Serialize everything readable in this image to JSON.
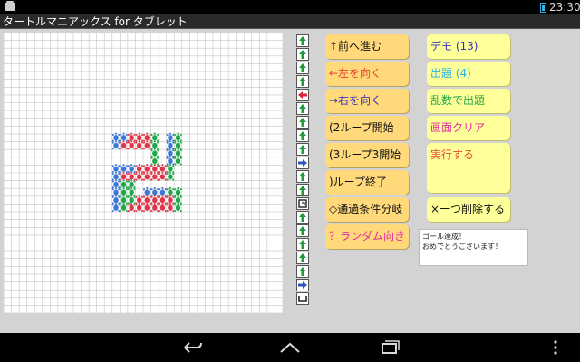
{
  "status_bar": {
    "time": "23:30",
    "app_icon": "game-controller-icon",
    "battery_icon": "battery-icon"
  },
  "title_bar": {
    "title": "タートルマニアックス for タブレット"
  },
  "turtle_canvas": {
    "grid_size": 36,
    "colors": {
      "blue": "#3b78d9",
      "red": "#e0364a",
      "green": "#22a84a",
      "grid": "#c4c4c4"
    },
    "turtles": [
      {
        "col": 14,
        "row": 13,
        "color": "blue"
      },
      {
        "col": 15,
        "row": 13,
        "color": "blue"
      },
      {
        "col": 16,
        "row": 13,
        "color": "red"
      },
      {
        "col": 17,
        "row": 13,
        "color": "red"
      },
      {
        "col": 18,
        "row": 13,
        "color": "red"
      },
      {
        "col": 19,
        "row": 13,
        "color": "green"
      },
      {
        "col": 21,
        "row": 13,
        "color": "blue"
      },
      {
        "col": 22,
        "row": 13,
        "color": "green"
      },
      {
        "col": 14,
        "row": 14,
        "color": "blue"
      },
      {
        "col": 15,
        "row": 14,
        "color": "red"
      },
      {
        "col": 16,
        "row": 14,
        "color": "red"
      },
      {
        "col": 17,
        "row": 14,
        "color": "red"
      },
      {
        "col": 18,
        "row": 14,
        "color": "red"
      },
      {
        "col": 19,
        "row": 14,
        "color": "green"
      },
      {
        "col": 21,
        "row": 14,
        "color": "blue"
      },
      {
        "col": 22,
        "row": 14,
        "color": "green"
      },
      {
        "col": 19,
        "row": 15,
        "color": "green"
      },
      {
        "col": 21,
        "row": 15,
        "color": "blue"
      },
      {
        "col": 22,
        "row": 15,
        "color": "green"
      },
      {
        "col": 19,
        "row": 16,
        "color": "green"
      },
      {
        "col": 21,
        "row": 16,
        "color": "blue"
      },
      {
        "col": 22,
        "row": 16,
        "color": "green"
      },
      {
        "col": 14,
        "row": 17,
        "color": "blue"
      },
      {
        "col": 15,
        "row": 17,
        "color": "blue"
      },
      {
        "col": 16,
        "row": 17,
        "color": "blue"
      },
      {
        "col": 17,
        "row": 17,
        "color": "red"
      },
      {
        "col": 18,
        "row": 17,
        "color": "red"
      },
      {
        "col": 19,
        "row": 17,
        "color": "red"
      },
      {
        "col": 20,
        "row": 17,
        "color": "red"
      },
      {
        "col": 21,
        "row": 17,
        "color": "green"
      },
      {
        "col": 14,
        "row": 18,
        "color": "blue"
      },
      {
        "col": 15,
        "row": 18,
        "color": "red"
      },
      {
        "col": 16,
        "row": 18,
        "color": "red"
      },
      {
        "col": 17,
        "row": 18,
        "color": "red"
      },
      {
        "col": 18,
        "row": 18,
        "color": "red"
      },
      {
        "col": 19,
        "row": 18,
        "color": "red"
      },
      {
        "col": 20,
        "row": 18,
        "color": "red"
      },
      {
        "col": 21,
        "row": 18,
        "color": "green"
      },
      {
        "col": 14,
        "row": 19,
        "color": "blue"
      },
      {
        "col": 15,
        "row": 19,
        "color": "green"
      },
      {
        "col": 16,
        "row": 19,
        "color": "green"
      },
      {
        "col": 14,
        "row": 20,
        "color": "blue"
      },
      {
        "col": 15,
        "row": 20,
        "color": "green"
      },
      {
        "col": 16,
        "row": 20,
        "color": "green"
      },
      {
        "col": 18,
        "row": 20,
        "color": "blue"
      },
      {
        "col": 19,
        "row": 20,
        "color": "blue"
      },
      {
        "col": 20,
        "row": 20,
        "color": "blue"
      },
      {
        "col": 21,
        "row": 20,
        "color": "green"
      },
      {
        "col": 22,
        "row": 20,
        "color": "green"
      },
      {
        "col": 14,
        "row": 21,
        "color": "blue"
      },
      {
        "col": 15,
        "row": 21,
        "color": "green"
      },
      {
        "col": 16,
        "row": 21,
        "color": "green"
      },
      {
        "col": 17,
        "row": 21,
        "color": "red"
      },
      {
        "col": 18,
        "row": 21,
        "color": "red"
      },
      {
        "col": 19,
        "row": 21,
        "color": "red"
      },
      {
        "col": 20,
        "row": 21,
        "color": "red"
      },
      {
        "col": 21,
        "row": 21,
        "color": "red"
      },
      {
        "col": 22,
        "row": 21,
        "color": "green"
      },
      {
        "col": 14,
        "row": 22,
        "color": "blue"
      },
      {
        "col": 15,
        "row": 22,
        "color": "green"
      },
      {
        "col": 16,
        "row": 22,
        "color": "red"
      },
      {
        "col": 17,
        "row": 22,
        "color": "red"
      },
      {
        "col": 18,
        "row": 22,
        "color": "red"
      },
      {
        "col": 19,
        "row": 22,
        "color": "red"
      },
      {
        "col": 20,
        "row": 22,
        "color": "red"
      },
      {
        "col": 21,
        "row": 22,
        "color": "red"
      },
      {
        "col": 22,
        "row": 22,
        "color": "green"
      }
    ]
  },
  "command_list": [
    {
      "icon": "up-arrow-icon",
      "color": "#1f9a3a"
    },
    {
      "icon": "up-arrow-icon",
      "color": "#1f9a3a"
    },
    {
      "icon": "up-arrow-icon",
      "color": "#1f9a3a"
    },
    {
      "icon": "up-arrow-icon",
      "color": "#1f9a3a"
    },
    {
      "icon": "left-arrow-icon",
      "color": "#d8243a"
    },
    {
      "icon": "up-arrow-icon",
      "color": "#1f9a3a"
    },
    {
      "icon": "up-arrow-icon",
      "color": "#1f9a3a"
    },
    {
      "icon": "up-arrow-icon",
      "color": "#1f9a3a"
    },
    {
      "icon": "up-arrow-icon",
      "color": "#1f9a3a"
    },
    {
      "icon": "right-arrow-icon",
      "color": "#2d55c8"
    },
    {
      "icon": "up-arrow-icon",
      "color": "#1f9a3a"
    },
    {
      "icon": "up-arrow-icon",
      "color": "#1f9a3a"
    },
    {
      "icon": "loop-icon",
      "color": "#222222"
    },
    {
      "icon": "up-arrow-icon",
      "color": "#1f9a3a"
    },
    {
      "icon": "up-arrow-icon",
      "color": "#1f9a3a"
    },
    {
      "icon": "up-arrow-icon",
      "color": "#1f9a3a"
    },
    {
      "icon": "up-arrow-icon",
      "color": "#1f9a3a"
    },
    {
      "icon": "up-arrow-icon",
      "color": "#1f9a3a"
    },
    {
      "icon": "right-arrow-icon",
      "color": "#2d55c8"
    },
    {
      "icon": "loop-end-icon",
      "color": "#222222"
    }
  ],
  "command_buttons": [
    {
      "label": "↑前へ進む",
      "color": "#111111"
    },
    {
      "label": "←左を向く",
      "color": "#e8462f"
    },
    {
      "label": "→右を向く",
      "color": "#3a35b8"
    },
    {
      "label": "(2ループ開始",
      "color": "#111111"
    },
    {
      "label": "(3ループ3開始",
      "color": "#111111"
    },
    {
      "label": ")ループ終了",
      "color": "#111111"
    },
    {
      "label": "◇通過条件分岐",
      "color": "#111111"
    },
    {
      "label": "？ランダム向き",
      "color": "#e02aa0"
    }
  ],
  "action_buttons": [
    {
      "label": "デモ (13)",
      "color": "#3a35b8"
    },
    {
      "label": "出題 (4)",
      "color": "#22b5e8"
    },
    {
      "label": "乱数で出題",
      "color": "#22a84a"
    },
    {
      "label": "画面クリア",
      "color": "#e02aa0"
    },
    {
      "label": "実行する",
      "color": "#e8462f"
    },
    {
      "label": "×一つ削除する",
      "color": "#111111"
    }
  ],
  "message": {
    "line1": "ゴール達成！",
    "line2": "おめでとうございます！"
  },
  "nav_bar": {
    "back": "back-icon",
    "home": "home-icon",
    "recents": "recents-icon",
    "menu": "menu-dots-icon"
  }
}
